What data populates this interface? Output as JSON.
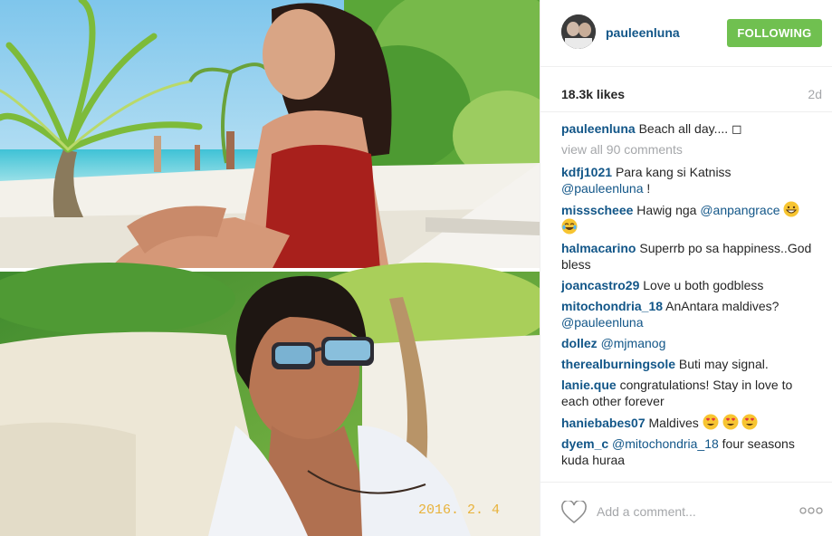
{
  "post": {
    "username": "pauleenluna",
    "follow_label": "FOLLOWING",
    "likes": "18.3k likes",
    "age": "2d",
    "photo_stamp": "2016. 2. 4"
  },
  "caption": {
    "author": "pauleenluna",
    "text": "Beach all day.... ◻"
  },
  "view_all_label": "view all 90 comments",
  "comments": [
    {
      "author": "kdfj1021",
      "text": "Para kang si Katniss ",
      "mention": "@pauleenluna",
      "tail": " !"
    },
    {
      "author": "missscheee",
      "text": "Hawig nga ",
      "mention": "@anpangrace",
      "tail": ""
    },
    {
      "author": "halmacarino",
      "text": "Superrb po sa happiness..God bless",
      "mention": "",
      "tail": ""
    },
    {
      "author": "joancastro29",
      "text": "Love u both godbless",
      "mention": "",
      "tail": ""
    },
    {
      "author": "mitochondria_18",
      "text": "AnAntara maldives? ",
      "mention": "@pauleenluna",
      "tail": ""
    },
    {
      "author": "dollez",
      "text": "",
      "mention": "@mjmanog",
      "tail": ""
    },
    {
      "author": "therealburningsole",
      "text": "Buti may signal.",
      "mention": "",
      "tail": ""
    },
    {
      "author": "lanie.que",
      "text": "congratulations! Stay in love to each other forever",
      "mention": "",
      "tail": ""
    },
    {
      "author": "haniebabes07",
      "text": "Maldives ",
      "mention": "",
      "tail": ""
    },
    {
      "author": "dyem_c",
      "text": "",
      "mention": "@mitochondria_18",
      "tail": " four seasons kuda huraa"
    }
  ],
  "add_comment_placeholder": "Add a comment...",
  "icons": {
    "like": "heart-outline-icon",
    "more": "ellipsis-icon",
    "emoji_grin": "grinning-face-icon",
    "emoji_laugh": "tears-of-joy-icon",
    "emoji_heart_eyes": "heart-eyes-icon"
  },
  "colors": {
    "link": "#125688",
    "follow_button": "#70c050",
    "muted": "#a5a7aa"
  }
}
